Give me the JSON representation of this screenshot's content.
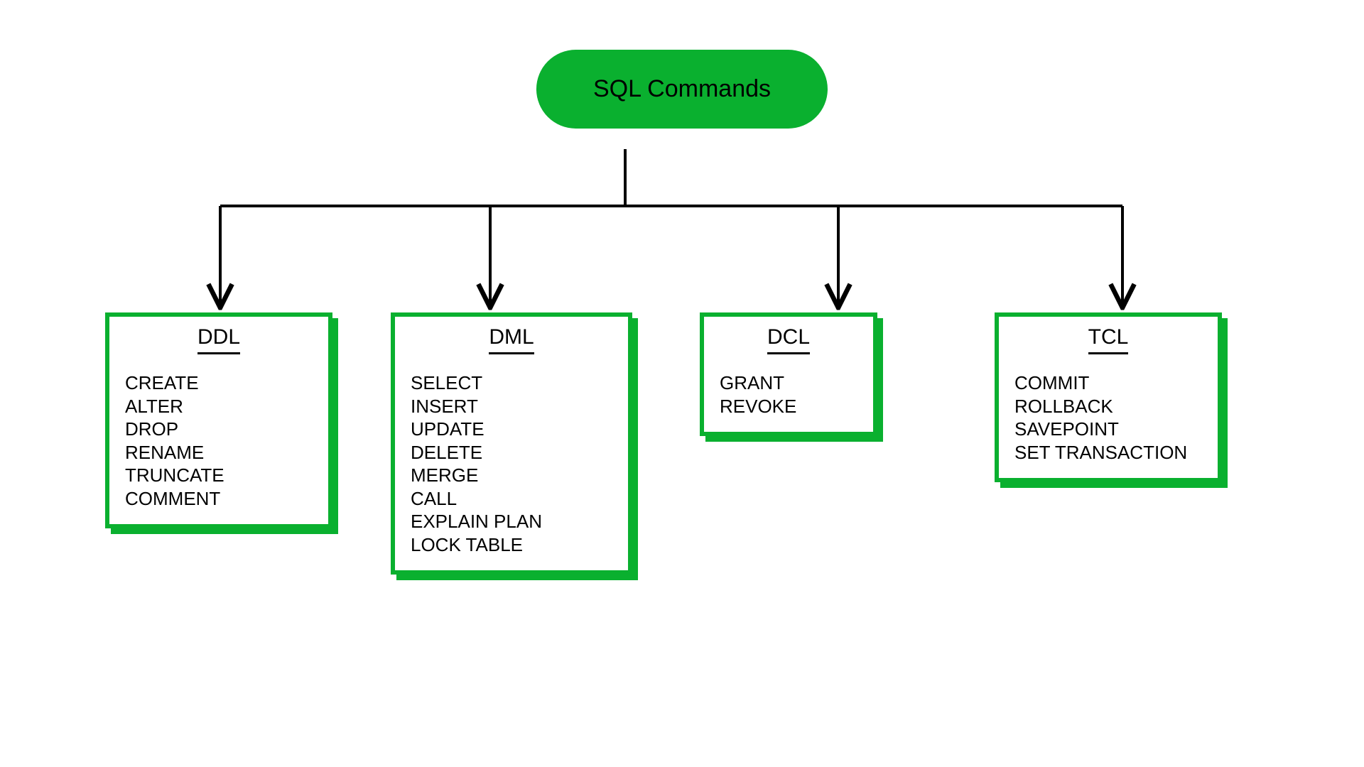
{
  "root": {
    "label": "SQL Commands"
  },
  "categories": [
    {
      "title": "DDL",
      "items": [
        "CREATE",
        "ALTER",
        "DROP",
        "RENAME",
        "TRUNCATE",
        "COMMENT"
      ]
    },
    {
      "title": "DML",
      "items": [
        "SELECT",
        "INSERT",
        "UPDATE",
        "DELETE",
        "MERGE",
        "CALL",
        "EXPLAIN PLAN",
        "LOCK TABLE"
      ]
    },
    {
      "title": "DCL",
      "items": [
        "GRANT",
        "REVOKE"
      ]
    },
    {
      "title": "TCL",
      "items": [
        "COMMIT",
        "ROLLBACK",
        "SAVEPOINT",
        "SET TRANSACTION"
      ]
    }
  ],
  "colors": {
    "accent": "#0ab02f",
    "stroke": "#000000"
  }
}
